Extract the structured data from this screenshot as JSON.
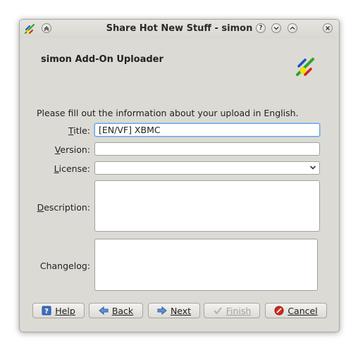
{
  "window": {
    "title": "Share Hot New Stuff - simon",
    "titlebar_buttons": [
      "?",
      "⌄",
      "^",
      "×"
    ]
  },
  "header": {
    "title": "simon Add-On Uploader",
    "icon": "simon-logo-icon"
  },
  "intro": "Please fill out the information about your upload in English.",
  "form": {
    "title": {
      "label_key": "T",
      "label_rest": "itle:",
      "value": "[EN/VF] XBMC"
    },
    "version": {
      "label_key": "V",
      "label_rest": "ersion:",
      "value": ""
    },
    "license": {
      "label_key": "L",
      "label_rest": "icense:",
      "value": ""
    },
    "description": {
      "label_key": "D",
      "label_rest": "escription:",
      "value": ""
    },
    "changelog": {
      "label": "Changelog:",
      "value": ""
    }
  },
  "buttons": {
    "help": {
      "label": "Help",
      "icon": "help-icon"
    },
    "back": {
      "label": "Back",
      "icon": "arrow-left-icon"
    },
    "next": {
      "label": "Next",
      "icon": "arrow-right-icon"
    },
    "finish": {
      "label": "Finish",
      "icon": "checkmark-icon",
      "disabled": true
    },
    "cancel": {
      "label": "Cancel",
      "icon": "cancel-icon"
    }
  },
  "colors": {
    "window_bg": "#dcdad5",
    "focus_border": "#6aa3d8",
    "disabled_text": "#a5a39f",
    "cancel_red": "#d42a1f",
    "arrow_blue": "#3b78c6"
  }
}
